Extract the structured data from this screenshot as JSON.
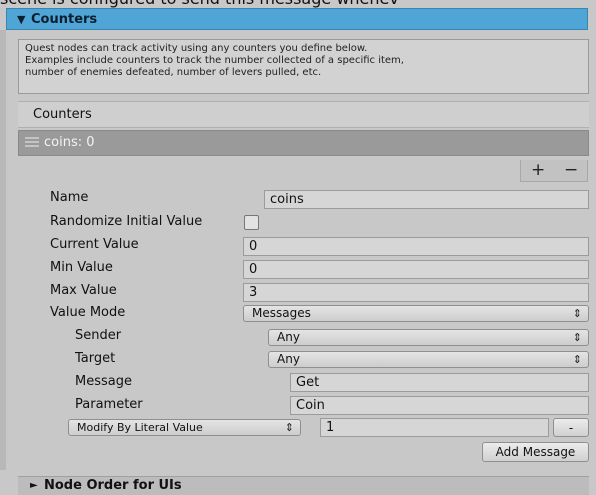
{
  "top_text": "scene is configured to send this message whenev",
  "section": {
    "title": "Counters",
    "arrow": "▼"
  },
  "help": {
    "lines": [
      "Quest nodes can track activity using any counters you define below.",
      "Examples include counters to track the number collected of a specific item,",
      "number of enemies defeated, number of levers pulled, etc."
    ]
  },
  "list": {
    "header": "Counters",
    "item_label": "coins: 0",
    "add": "+",
    "remove": "−"
  },
  "fields": {
    "name_label": "Name",
    "name_value": "coins",
    "randomize_label": "Randomize Initial Value",
    "randomize_checked": false,
    "current_label": "Current Value",
    "current_value": "0",
    "min_label": "Min Value",
    "min_value": "0",
    "max_label": "Max Value",
    "max_value": "3",
    "mode_label": "Value Mode",
    "mode_value": "Messages"
  },
  "message": {
    "sender_label": "Sender",
    "sender_value": "Any",
    "target_label": "Target",
    "target_value": "Any",
    "message_label": "Message",
    "message_value": "Get",
    "parameter_label": "Parameter",
    "parameter_value": "Coin",
    "modify_value": "Modify By Literal Value",
    "literal_value": "1",
    "remove_button": "-",
    "add_message_button": "Add Message"
  },
  "footer": {
    "title": "Node Order for UIs",
    "arrow": "►"
  },
  "colors": {
    "header_blue": "#4fa6d6",
    "item_gray": "#9a9a9a",
    "panel": "#c8c8c8"
  }
}
